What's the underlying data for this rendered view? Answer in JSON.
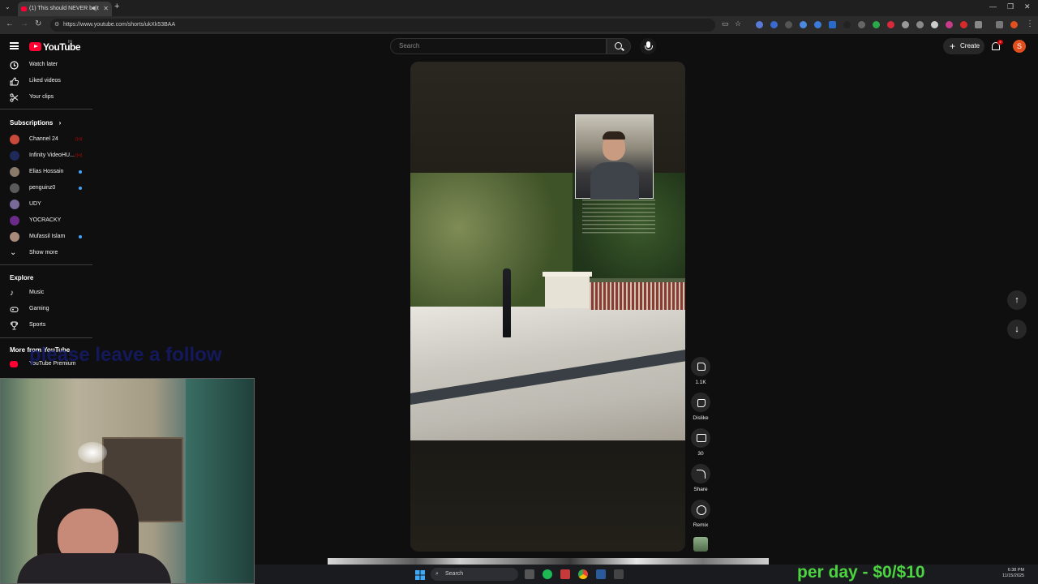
{
  "browser": {
    "tab_title": "(1) This should NEVER be t",
    "url": "https://www.youtube.com/shorts/ukXk53BAA"
  },
  "youtube": {
    "logo_text": "YouTube",
    "region_badge": "IN",
    "search_placeholder": "Search",
    "create_label": "Create",
    "notif_count": "9",
    "avatar_letter": "S"
  },
  "sidebar": {
    "top_items": [
      {
        "label": "Watch later",
        "icon": "clock-icon"
      },
      {
        "label": "Liked videos",
        "icon": "thumbs-up-icon"
      },
      {
        "label": "Your clips",
        "icon": "scissors-icon"
      }
    ],
    "subscriptions_title": "Subscriptions",
    "subscriptions": [
      {
        "label": "Channel 24",
        "status": "live",
        "avatar_color": "#c94a3a"
      },
      {
        "label": "Infinity VideoHU...",
        "status": "live",
        "avatar_color": "#1d2a5a"
      },
      {
        "label": "Elias Hossain",
        "status": "new",
        "avatar_color": "#8a7a6a"
      },
      {
        "label": "penguinz0",
        "status": "new",
        "avatar_color": "#5a5a5a"
      },
      {
        "label": "UDY",
        "status": "",
        "avatar_color": "#7a6a9a"
      },
      {
        "label": "YOCRACKY",
        "status": "",
        "avatar_color": "#6a2a8a"
      },
      {
        "label": "Mufassil Islam",
        "status": "new",
        "avatar_color": "#aa8a7a"
      }
    ],
    "show_more": "Show more",
    "explore_title": "Explore",
    "explore": [
      {
        "label": "Music",
        "icon": "music-note-icon"
      },
      {
        "label": "Gaming",
        "icon": "gamepad-icon"
      },
      {
        "label": "Sports",
        "icon": "trophy-icon"
      }
    ],
    "more_title": "More from YouTube",
    "more": [
      {
        "label": "YouTube Premium"
      }
    ]
  },
  "shorts": {
    "likes": "1.1K",
    "dislike_label": "Dislike",
    "comments": "30",
    "share_label": "Share",
    "remix_label": "Remix"
  },
  "overlays": {
    "follow_text": "please leave a follow",
    "money_text": "per day - $0/$10"
  },
  "taskbar": {
    "search_label": "Search",
    "time": "6:38 PM",
    "date": "11/15/2025"
  }
}
